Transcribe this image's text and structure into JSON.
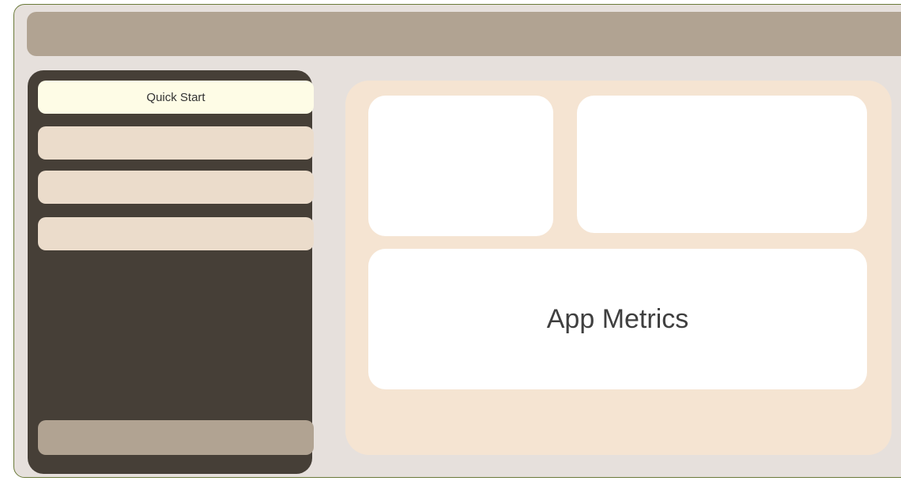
{
  "sidebar": {
    "items": [
      {
        "label": "Quick Start",
        "active": true
      },
      {
        "label": "",
        "active": false
      },
      {
        "label": "",
        "active": false
      },
      {
        "label": "",
        "active": false
      }
    ],
    "footer_button_label": ""
  },
  "main": {
    "cards": [
      {
        "label": ""
      },
      {
        "label": ""
      },
      {
        "label": "App Metrics"
      }
    ]
  },
  "colors": {
    "window_bg": "#e6e0dc",
    "top_bar": "#b1a392",
    "sidebar_bg": "#463f37",
    "nav_item": "#ebdccb",
    "nav_item_active": "#fefce6",
    "content_bg": "#f5e4d2",
    "card_bg": "#ffffff"
  }
}
